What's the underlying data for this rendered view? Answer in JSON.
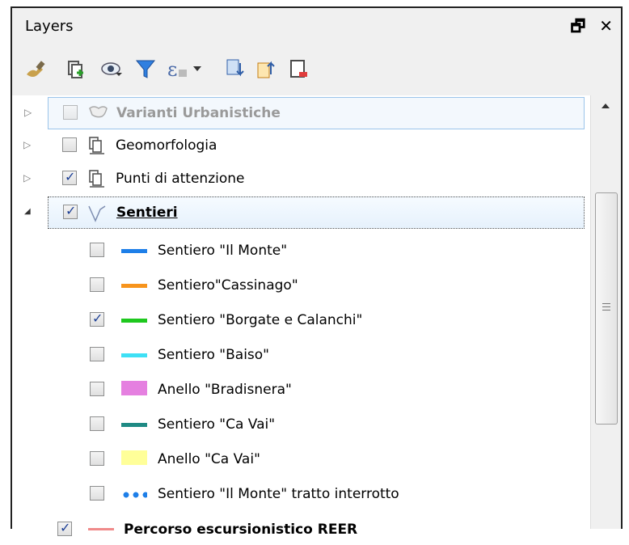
{
  "panel": {
    "title": "Layers",
    "float_icon": "float-icon",
    "close_icon": "close-icon",
    "close_glyph": "✕",
    "float_glyph": "🗗"
  },
  "toolbar": {
    "icons": [
      "style-brush-icon",
      "add-group-icon",
      "visibility-eye-icon",
      "filter-icon",
      "expression-filter-icon",
      "expand-all-icon",
      "collapse-all-icon",
      "remove-layer-icon"
    ]
  },
  "layers": [
    {
      "label": "Varianti Urbanistiche",
      "checked": false,
      "disabled": true,
      "expanded": false,
      "icon": "polygon-layer-icon"
    },
    {
      "label": "Geomorfologia",
      "checked": false,
      "expanded": false,
      "icon": "group-icon"
    },
    {
      "label": "Punti di attenzione",
      "checked": true,
      "expanded": false,
      "icon": "group-icon"
    },
    {
      "label": "Sentieri",
      "checked": true,
      "expanded": true,
      "icon": "line-layer-icon",
      "bold": true
    }
  ],
  "sentieri_items": [
    {
      "label": "Sentiero \"Il Monte\"",
      "checked": false,
      "color": "#1e7fe8",
      "style": "line"
    },
    {
      "label": "Sentiero\"Cassinago\"",
      "checked": false,
      "color": "#f7941d",
      "style": "line"
    },
    {
      "label": "Sentiero \"Borgate e Calanchi\"",
      "checked": true,
      "color": "#1ec81e",
      "style": "line"
    },
    {
      "label": "Sentiero \"Baiso\"",
      "checked": false,
      "color": "#3ee0f5",
      "style": "line"
    },
    {
      "label": "Anello \"Bradisnera\"",
      "checked": false,
      "color": "#e580e0",
      "style": "fill"
    },
    {
      "label": "Sentiero \"Ca Vai\"",
      "checked": false,
      "color": "#1f8a84",
      "style": "line"
    },
    {
      "label": "Anello \"Ca Vai\"",
      "checked": false,
      "color": "#ffff99",
      "style": "fill"
    },
    {
      "label": "Sentiero \"Il Monte\" tratto interrotto",
      "checked": false,
      "color": "#1e7fe8",
      "style": "dots"
    }
  ],
  "bottom_layer": {
    "label": "Percorso escursionistico REER",
    "checked": true,
    "color": "#f08a8a"
  }
}
